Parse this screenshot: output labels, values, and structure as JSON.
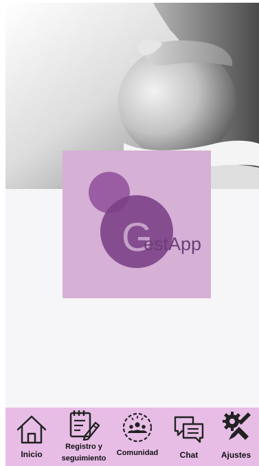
{
  "app": {
    "logo_text": "GestApp"
  },
  "colors": {
    "nav_background": "#e7bde6",
    "logo_card": "#d6b0d5",
    "logo_circle_primary": "#7a3f86",
    "logo_circle_secondary": "#8f4f9a"
  },
  "hero": {
    "image": "pregnant-belly-photo"
  },
  "bottom_nav": {
    "items": [
      {
        "label": "Inicio",
        "icon": "home-icon"
      },
      {
        "label": "Registro y seguimiento",
        "icon": "checklist-pencil-icon"
      },
      {
        "label": "Comunidad",
        "icon": "community-icon"
      },
      {
        "label": "Chat",
        "icon": "chat-bubbles-icon"
      },
      {
        "label": "Ajustes",
        "icon": "settings-tools-icon"
      }
    ]
  }
}
